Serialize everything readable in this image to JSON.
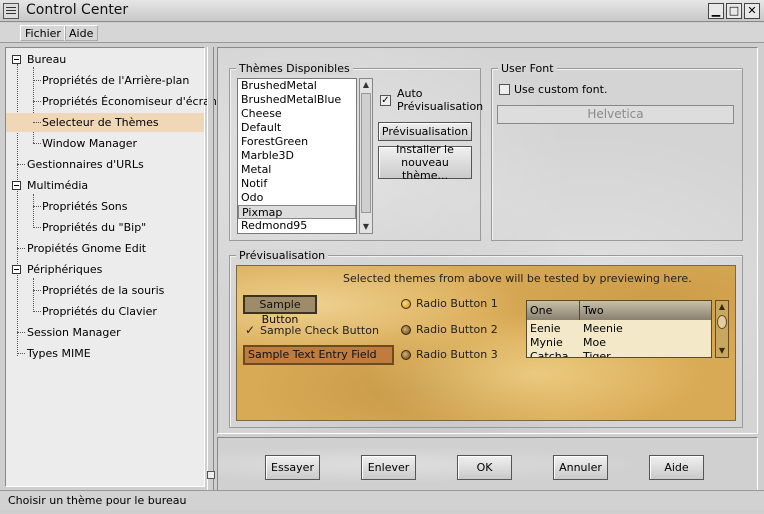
{
  "window": {
    "title": "Control Center"
  },
  "menubar": {
    "items": [
      "Fichier",
      "Aide"
    ]
  },
  "sidebar": {
    "items": [
      {
        "label": "Bureau"
      },
      {
        "label": "Propriétés de l'Arrière-plan"
      },
      {
        "label": "Propriétés Économiseur d'écran"
      },
      {
        "label": "Selecteur de Thèmes"
      },
      {
        "label": "Window Manager"
      },
      {
        "label": "Gestionnaires d'URLs"
      },
      {
        "label": "Multimédia"
      },
      {
        "label": "Propriétés Sons"
      },
      {
        "label": "Propriétés du \"Bip\""
      },
      {
        "label": "Propiétés Gnome Edit"
      },
      {
        "label": "Périphériques"
      },
      {
        "label": "Propriétés de la souris"
      },
      {
        "label": "Propriétés du Clavier"
      },
      {
        "label": "Session Manager"
      },
      {
        "label": "Types MIME"
      }
    ]
  },
  "themes": {
    "section_title": "Thèmes Disponibles",
    "items": [
      "BrushedMetal",
      "BrushedMetalBlue",
      "Cheese",
      "Default",
      "ForestGreen",
      "Marble3D",
      "Metal",
      "Notif",
      "Odo",
      "Pixmap",
      "Redmond95"
    ],
    "selected": "Pixmap",
    "auto_preview_label": "Auto Prévisualisation",
    "auto_preview_checked": true,
    "preview_button": "Prévisualisation",
    "install_button": "Installer le nouveau thème..."
  },
  "user_font": {
    "section_title": "User Font",
    "custom_font_label": "Use custom font.",
    "font_button": "Helvetica"
  },
  "preview": {
    "section_title": "Prévisualisation",
    "hint": "Selected themes from above will be tested by previewing here.",
    "sample_button": "Sample Button",
    "sample_check": "Sample Check Button",
    "sample_entry": "Sample Text Entry Field",
    "radios": [
      "Radio Button 1",
      "Radio Button 2",
      "Radio Button 3"
    ],
    "table": {
      "headers": [
        "One",
        "Two"
      ],
      "rows": [
        [
          "Eenie",
          "Meenie"
        ],
        [
          "Mynie",
          "Moe"
        ],
        [
          "Catcha",
          "Tiger"
        ]
      ]
    }
  },
  "buttons": {
    "try": "Essayer",
    "revert": "Enlever",
    "ok": "OK",
    "cancel": "Annuler",
    "help": "Aide"
  },
  "status": {
    "text": "Choisir un thème pour le bureau"
  }
}
